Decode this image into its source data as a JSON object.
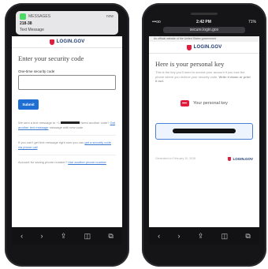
{
  "left": {
    "notification": {
      "app": "MESSAGES",
      "time": "now",
      "from": "218-38",
      "message": "Text Message"
    },
    "brand": "LOGIN.GOV",
    "title": "Enter your security code",
    "field_label": "One-time security code",
    "submit_label": "Submit",
    "para1_a": "We sent a text message to +1",
    "para1_b": "Need another code?",
    "para1_link": "Get another text message",
    "para1_c": "message with new code",
    "para2_a": "If you can't get text message right now you can",
    "para2_link": "get a security code via phone call",
    "para3_a": "Account for saving phone number?",
    "para3_link": "Use another phone number",
    "toolbar": [
      "‹",
      "›",
      "⇪",
      "◫",
      "⧉"
    ]
  },
  "right": {
    "status": {
      "carrier": "•••oo",
      "time": "2:42 PM",
      "battery": "71%"
    },
    "url": "secure.login.gov",
    "banner": "An official website of the United States government",
    "brand": "LOGIN.GOV",
    "title": "Here is your personal key",
    "intro": "This is the key you'll need to access your account if you lose the phone where you recieve your security code.",
    "intro_bold": "Write it down or print it out.",
    "key_label": "Your personal key",
    "footer_date": "Generated on February 10, 2018",
    "footer_brand": "LOGIN.GOV",
    "toolbar": [
      "‹",
      "›",
      "⇪",
      "◫",
      "⧉"
    ]
  }
}
